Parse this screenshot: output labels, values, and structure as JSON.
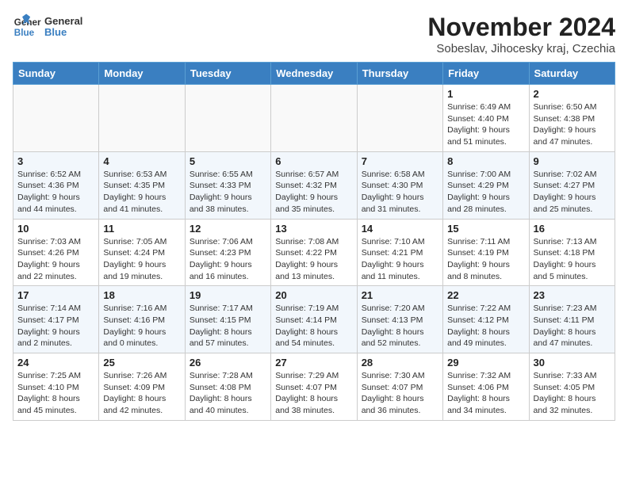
{
  "header": {
    "logo_line1": "General",
    "logo_line2": "Blue",
    "month_title": "November 2024",
    "location": "Sobeslav, Jihocesky kraj, Czechia"
  },
  "weekdays": [
    "Sunday",
    "Monday",
    "Tuesday",
    "Wednesday",
    "Thursday",
    "Friday",
    "Saturday"
  ],
  "weeks": [
    [
      {
        "day": "",
        "detail": ""
      },
      {
        "day": "",
        "detail": ""
      },
      {
        "day": "",
        "detail": ""
      },
      {
        "day": "",
        "detail": ""
      },
      {
        "day": "",
        "detail": ""
      },
      {
        "day": "1",
        "detail": "Sunrise: 6:49 AM\nSunset: 4:40 PM\nDaylight: 9 hours\nand 51 minutes."
      },
      {
        "day": "2",
        "detail": "Sunrise: 6:50 AM\nSunset: 4:38 PM\nDaylight: 9 hours\nand 47 minutes."
      }
    ],
    [
      {
        "day": "3",
        "detail": "Sunrise: 6:52 AM\nSunset: 4:36 PM\nDaylight: 9 hours\nand 44 minutes."
      },
      {
        "day": "4",
        "detail": "Sunrise: 6:53 AM\nSunset: 4:35 PM\nDaylight: 9 hours\nand 41 minutes."
      },
      {
        "day": "5",
        "detail": "Sunrise: 6:55 AM\nSunset: 4:33 PM\nDaylight: 9 hours\nand 38 minutes."
      },
      {
        "day": "6",
        "detail": "Sunrise: 6:57 AM\nSunset: 4:32 PM\nDaylight: 9 hours\nand 35 minutes."
      },
      {
        "day": "7",
        "detail": "Sunrise: 6:58 AM\nSunset: 4:30 PM\nDaylight: 9 hours\nand 31 minutes."
      },
      {
        "day": "8",
        "detail": "Sunrise: 7:00 AM\nSunset: 4:29 PM\nDaylight: 9 hours\nand 28 minutes."
      },
      {
        "day": "9",
        "detail": "Sunrise: 7:02 AM\nSunset: 4:27 PM\nDaylight: 9 hours\nand 25 minutes."
      }
    ],
    [
      {
        "day": "10",
        "detail": "Sunrise: 7:03 AM\nSunset: 4:26 PM\nDaylight: 9 hours\nand 22 minutes."
      },
      {
        "day": "11",
        "detail": "Sunrise: 7:05 AM\nSunset: 4:24 PM\nDaylight: 9 hours\nand 19 minutes."
      },
      {
        "day": "12",
        "detail": "Sunrise: 7:06 AM\nSunset: 4:23 PM\nDaylight: 9 hours\nand 16 minutes."
      },
      {
        "day": "13",
        "detail": "Sunrise: 7:08 AM\nSunset: 4:22 PM\nDaylight: 9 hours\nand 13 minutes."
      },
      {
        "day": "14",
        "detail": "Sunrise: 7:10 AM\nSunset: 4:21 PM\nDaylight: 9 hours\nand 11 minutes."
      },
      {
        "day": "15",
        "detail": "Sunrise: 7:11 AM\nSunset: 4:19 PM\nDaylight: 9 hours\nand 8 minutes."
      },
      {
        "day": "16",
        "detail": "Sunrise: 7:13 AM\nSunset: 4:18 PM\nDaylight: 9 hours\nand 5 minutes."
      }
    ],
    [
      {
        "day": "17",
        "detail": "Sunrise: 7:14 AM\nSunset: 4:17 PM\nDaylight: 9 hours\nand 2 minutes."
      },
      {
        "day": "18",
        "detail": "Sunrise: 7:16 AM\nSunset: 4:16 PM\nDaylight: 9 hours\nand 0 minutes."
      },
      {
        "day": "19",
        "detail": "Sunrise: 7:17 AM\nSunset: 4:15 PM\nDaylight: 8 hours\nand 57 minutes."
      },
      {
        "day": "20",
        "detail": "Sunrise: 7:19 AM\nSunset: 4:14 PM\nDaylight: 8 hours\nand 54 minutes."
      },
      {
        "day": "21",
        "detail": "Sunrise: 7:20 AM\nSunset: 4:13 PM\nDaylight: 8 hours\nand 52 minutes."
      },
      {
        "day": "22",
        "detail": "Sunrise: 7:22 AM\nSunset: 4:12 PM\nDaylight: 8 hours\nand 49 minutes."
      },
      {
        "day": "23",
        "detail": "Sunrise: 7:23 AM\nSunset: 4:11 PM\nDaylight: 8 hours\nand 47 minutes."
      }
    ],
    [
      {
        "day": "24",
        "detail": "Sunrise: 7:25 AM\nSunset: 4:10 PM\nDaylight: 8 hours\nand 45 minutes."
      },
      {
        "day": "25",
        "detail": "Sunrise: 7:26 AM\nSunset: 4:09 PM\nDaylight: 8 hours\nand 42 minutes."
      },
      {
        "day": "26",
        "detail": "Sunrise: 7:28 AM\nSunset: 4:08 PM\nDaylight: 8 hours\nand 40 minutes."
      },
      {
        "day": "27",
        "detail": "Sunrise: 7:29 AM\nSunset: 4:07 PM\nDaylight: 8 hours\nand 38 minutes."
      },
      {
        "day": "28",
        "detail": "Sunrise: 7:30 AM\nSunset: 4:07 PM\nDaylight: 8 hours\nand 36 minutes."
      },
      {
        "day": "29",
        "detail": "Sunrise: 7:32 AM\nSunset: 4:06 PM\nDaylight: 8 hours\nand 34 minutes."
      },
      {
        "day": "30",
        "detail": "Sunrise: 7:33 AM\nSunset: 4:05 PM\nDaylight: 8 hours\nand 32 minutes."
      }
    ]
  ]
}
